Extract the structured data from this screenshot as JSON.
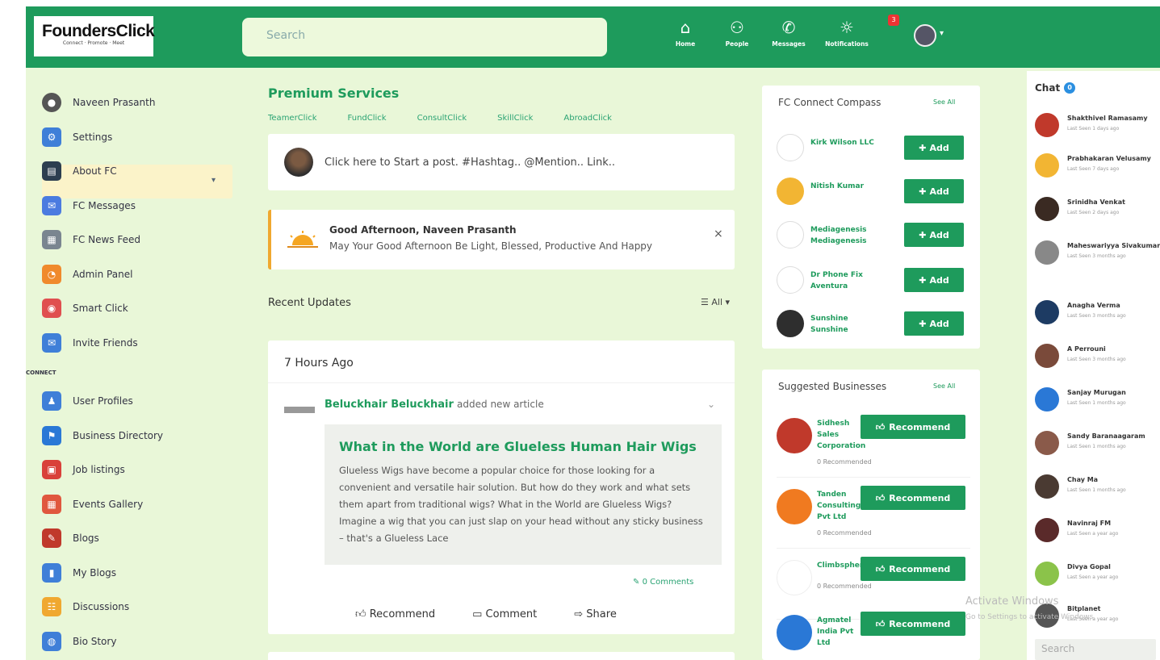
{
  "brand": {
    "name": "FoundersClick",
    "tagline": "Connect · Promote · Meet"
  },
  "topbar": {
    "search_placeholder": "Search",
    "nav": [
      {
        "label": "Home",
        "icon": "home-icon"
      },
      {
        "label": "People",
        "icon": "people-icon"
      },
      {
        "label": "Messages",
        "icon": "whatsapp-icon"
      },
      {
        "label": "Notifications",
        "icon": "bell-icon"
      }
    ],
    "notification_count": "3"
  },
  "sidebar": {
    "items": [
      {
        "label": "Naveen Prasanth",
        "icon": "avatar",
        "color": "#555"
      },
      {
        "label": "Settings",
        "icon": "gear-icon",
        "color": "#3f7fd8"
      },
      {
        "label": "About FC",
        "icon": "document-icon",
        "color": "#2c3e50"
      },
      {
        "label": "FC Messages",
        "icon": "chat-bubble-icon",
        "color": "#4b7be0"
      },
      {
        "label": "FC News Feed",
        "icon": "newspaper-icon",
        "color": "#7a8590"
      },
      {
        "label": "Admin Panel",
        "icon": "dashboard-icon",
        "color": "#f08a2c"
      },
      {
        "label": "Smart Click",
        "icon": "pointer-icon",
        "color": "#e04f4f"
      },
      {
        "label": "Invite Friends",
        "icon": "invite-icon",
        "color": "#3f7fd8"
      }
    ],
    "section_label": "CONNECT",
    "connect_items": [
      {
        "label": "User Profiles",
        "icon": "users-icon",
        "color": "#3f7fd8"
      },
      {
        "label": "Business Directory",
        "icon": "flag-icon",
        "color": "#2a78d6"
      },
      {
        "label": "Job listings",
        "icon": "briefcase-icon",
        "color": "#d9413a"
      },
      {
        "label": "Events Gallery",
        "icon": "calendar-icon",
        "color": "#e0573e"
      },
      {
        "label": "Blogs",
        "icon": "blog-icon",
        "color": "#c0392b"
      },
      {
        "label": "My Blogs",
        "icon": "notebook-icon",
        "color": "#3f7fd8"
      },
      {
        "label": "Discussions",
        "icon": "discussion-icon",
        "color": "#f0a830"
      },
      {
        "label": "Bio Story",
        "icon": "globe-icon",
        "color": "#3f7fd8"
      }
    ]
  },
  "premium": {
    "title": "Premium Services",
    "links": [
      "TeamerClick",
      "FundClick",
      "ConsultClick",
      "SkillClick",
      "AbroadClick"
    ]
  },
  "post_box": {
    "placeholder": "Click here to Start a post. #Hashtag.. @Mention.. Link.."
  },
  "greeting": {
    "title": "Good Afternoon, Naveen Prasanth",
    "message": "May Your Good Afternoon Be Light, Blessed, Productive And Happy",
    "close": "×"
  },
  "recent": {
    "label": "Recent Updates",
    "filter": "☰ All ▾"
  },
  "feed": {
    "time": "7 Hours Ago",
    "author": "Beluckhair Beluckhair",
    "action": "added new article",
    "article_title": "What in the World are Glueless Human Hair Wigs",
    "article_body": "Glueless Wigs have become a popular choice for those looking for a convenient and versatile hair solution. But how do they work and what sets them apart from traditional wigs? What in the World are Glueless Wigs? Imagine a wig that you can just slap on your head without any sticky business – that's a Glueless Lace",
    "comments": "0 Comments",
    "actions": [
      "Recommend",
      "Comment",
      "Share"
    ]
  },
  "connect": {
    "title": "FC Connect Compass",
    "see_all": "See All",
    "add_label": "Add",
    "people": [
      {
        "name": "Kirk Wilson LLC",
        "color": "#ffffff"
      },
      {
        "name": "Nitish Kumar",
        "color": "#f2b533"
      },
      {
        "name": "Mediagenesis Mediagenesis",
        "color": "#ffffff"
      },
      {
        "name": "Dr Phone Fix Aventura",
        "color": "#ffffff"
      },
      {
        "name": "Sunshine Sunshine",
        "color": "#2e2e2e"
      }
    ]
  },
  "businesses": {
    "title": "Suggested Businesses",
    "see_all": "See All",
    "recommend_label": "Recommend",
    "items": [
      {
        "name": "Sidhesh Sales Corporation",
        "recs": "0 Recommended",
        "color": "#c0392b"
      },
      {
        "name": "Tanden Consulting Pvt Ltd",
        "recs": "0 Recommended",
        "color": "#f07a20"
      },
      {
        "name": "Climbsphere",
        "recs": "0 Recommended",
        "color": "#ffffff"
      },
      {
        "name": "Agmatel India Pvt Ltd",
        "recs": "",
        "color": "#2a78d6"
      }
    ]
  },
  "chat": {
    "title": "Chat",
    "count": "0",
    "search_placeholder": "Search",
    "users": [
      {
        "name": "Shakthivel Ramasamy",
        "last": "Last Seen 1 days ago",
        "color": "#c0392b"
      },
      {
        "name": "Prabhakaran Velusamy",
        "last": "Last Seen 7 days ago",
        "color": "#f2b533"
      },
      {
        "name": "Srinidha Venkat",
        "last": "Last Seen 2 days ago",
        "color": "#3a2a22"
      },
      {
        "name": "Maheswariyya Sivakumar",
        "last": "Last Seen 3 months ago",
        "color": "#888"
      },
      {
        "name": "Anagha Verma",
        "last": "Last Seen 3 months ago",
        "color": "#1d3b63"
      },
      {
        "name": "A Perrouni",
        "last": "Last Seen 3 months ago",
        "color": "#7a4a3a"
      },
      {
        "name": "Sanjay Murugan",
        "last": "Last Seen 1 months ago",
        "color": "#2a78d6"
      },
      {
        "name": "Sandy Baranaagaram",
        "last": "Last Seen 1 months ago",
        "color": "#8a5a4a"
      },
      {
        "name": "Chay Ma",
        "last": "Last Seen 1 months ago",
        "color": "#4a3a32"
      },
      {
        "name": "Navinraj FM",
        "last": "Last Seen a year ago",
        "color": "#5a2a2a"
      },
      {
        "name": "Divya Gopal",
        "last": "Last Seen a year ago",
        "color": "#8bc34a"
      },
      {
        "name": "Bitplanet",
        "last": "Last Seen a year ago",
        "color": "#555"
      }
    ]
  },
  "watermark": {
    "line1": "Activate Windows",
    "line2": "Go to Settings to activate Windows."
  }
}
